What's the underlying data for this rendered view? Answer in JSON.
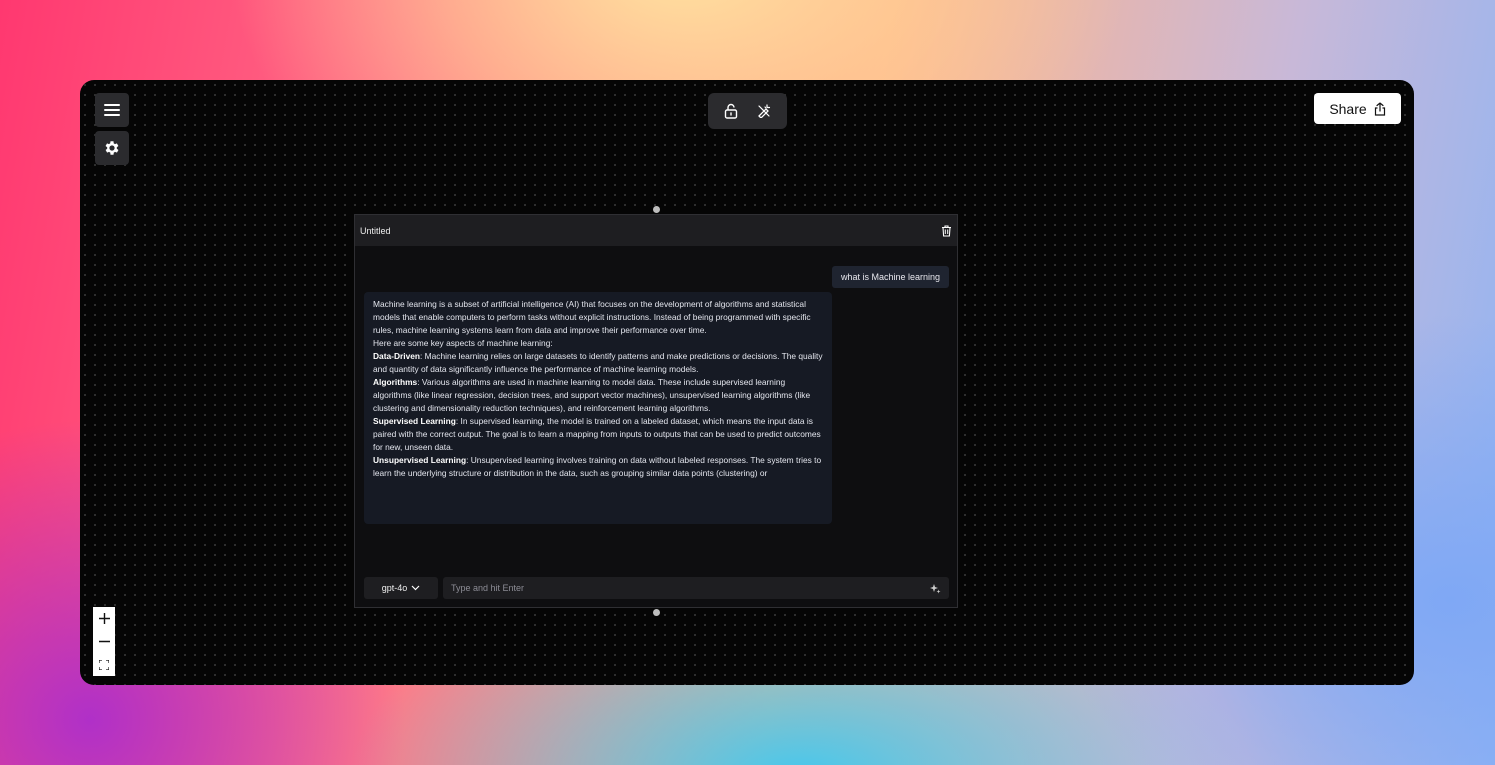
{
  "toolbar": {
    "share_label": "Share"
  },
  "node": {
    "title": "Untitled",
    "user_message": "what is Machine learning",
    "ai_response": {
      "intro": "Machine learning is a subset of artificial intelligence (AI) that focuses on the development of algorithms and statistical models that enable computers to perform tasks without explicit instructions. Instead of being programmed with specific rules, machine learning systems learn from data and improve their performance over time.",
      "aspects_heading": "Here are some key aspects of machine learning:",
      "points": [
        {
          "term": "Data-Driven",
          "text": ": Machine learning relies on large datasets to identify patterns and make predictions or decisions. The quality and quantity of data significantly influence the performance of machine learning models."
        },
        {
          "term": "Algorithms",
          "text": ": Various algorithms are used in machine learning to model data. These include supervised learning algorithms (like linear regression, decision trees, and support vector machines), unsupervised learning algorithms (like clustering and dimensionality reduction techniques), and reinforcement learning algorithms."
        },
        {
          "term": "Supervised Learning",
          "text": ": In supervised learning, the model is trained on a labeled dataset, which means the input data is paired with the correct output. The goal is to learn a mapping from inputs to outputs that can be used to predict outcomes for new, unseen data."
        },
        {
          "term": "Unsupervised Learning",
          "text": ": Unsupervised learning involves training on data without labeled responses. The system tries to learn the underlying structure or distribution in the data, such as grouping similar data points (clustering) or"
        }
      ]
    },
    "model_select": "gpt-4o",
    "input_placeholder": "Type and hit Enter"
  },
  "icons": [
    "menu-icon",
    "gear-icon",
    "unlock-icon",
    "wand-icon",
    "share-icon",
    "trash-icon",
    "chevron-down-icon",
    "sparkle-icon",
    "plus-icon",
    "minus-icon",
    "fit-view-icon"
  ]
}
